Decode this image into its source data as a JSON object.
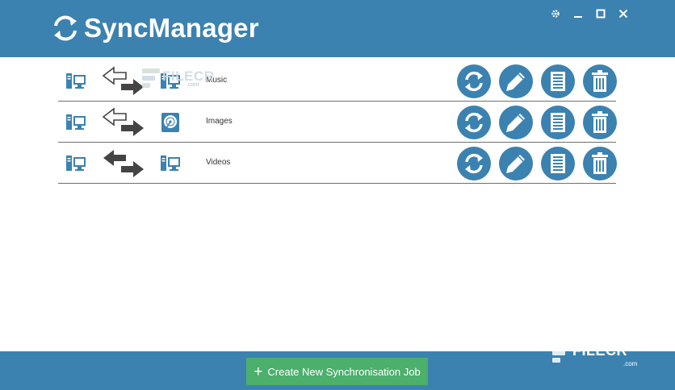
{
  "app": {
    "title": "SyncManager",
    "colors": {
      "brand": "#3b82b0",
      "create": "#4caf6c",
      "icon": "#3b82b0",
      "arrow": "#444444"
    }
  },
  "window_controls": {
    "icons": [
      "gear-icon",
      "minimize-icon",
      "maximize-icon",
      "close-icon"
    ]
  },
  "jobs": [
    {
      "name": "Music",
      "source_icon": "computer-icon",
      "direction": "left-outline-right-solid",
      "destination_icon": "computer-icon"
    },
    {
      "name": "Images",
      "source_icon": "computer-icon",
      "direction": "both-outline",
      "destination_icon": "hard-drive-icon"
    },
    {
      "name": "Videos",
      "source_icon": "computer-icon",
      "direction": "both-solid",
      "destination_icon": "computer-icon"
    }
  ],
  "row_actions": [
    "sync-icon",
    "edit-icon",
    "log-icon",
    "delete-icon"
  ],
  "watermark": {
    "brand": "FILECR",
    "sub": ".com"
  },
  "footer": {
    "create_label": "Create New Synchronisation Job"
  }
}
